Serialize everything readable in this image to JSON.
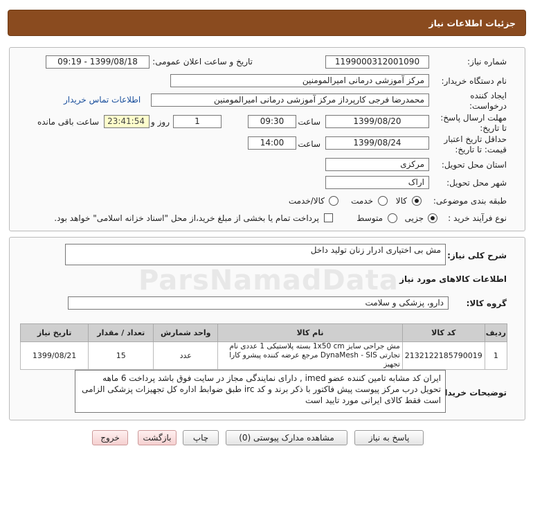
{
  "header": {
    "title": "جزئیات اطلاعات نیاز"
  },
  "info": {
    "need_number_label": "شماره نیاز:",
    "need_number": "1199000312001090",
    "announce_label": "تاریخ و ساعت اعلان عمومی:",
    "announce_value": "1399/08/18 - 09:19",
    "buyer_label": "نام دستگاه خریدار:",
    "buyer_value": "مرکز آموزشی درمانی امیرالمومنین",
    "creator_label_1": "ایجاد کننده",
    "creator_label_2": "درخواست:",
    "creator_value": "محمدرضا فرجی کارپرداز مرکز آموزشی درمانی امیرالمومنین",
    "contact_link": "اطلاعات تماس خریدار",
    "deadline_label_1": "مهلت ارسال پاسخ:",
    "deadline_label_2": "تا تاریخ:",
    "deadline_date": "1399/08/20",
    "time_label": "ساعت",
    "deadline_time": "09:30",
    "days_value": "1",
    "days_label": "روز و",
    "remaining_value": "23:41:54",
    "remaining_label": "ساعت باقی مانده",
    "validity_label_1": "حداقل تاریخ اعتبار",
    "validity_label_2": "قیمت: تا تاریخ:",
    "validity_date": "1399/08/24",
    "validity_time_label": "ساعت",
    "validity_time": "14:00",
    "province_label": "استان محل تحویل:",
    "province_value": "مرکزی",
    "city_label": "شهر محل تحویل:",
    "city_value": "اراک",
    "category_label": "طبقه بندی موضوعی:",
    "category_options": [
      "کالا",
      "خدمت",
      "کالا/خدمت"
    ],
    "category_selected": "کالا",
    "process_label": "نوع فرآیند خرید :",
    "process_options": [
      "جزیی",
      "متوسط"
    ],
    "process_selected": "جزیی",
    "payment_note": "پرداخت تمام یا بخشی از مبلغ خرید،از محل \"اسناد خزانه اسلامی\" خواهد بود."
  },
  "summary": {
    "label": "شرح کلی نیاز:",
    "value": "مش بی اختیاری ادرار زنان   تولید داخل"
  },
  "goods": {
    "section_title": "اطلاعات کالاهای مورد نیاز",
    "group_label": "گروه کالا:",
    "group_value": "دارو، پزشکی و سلامت",
    "columns": [
      "ردیف",
      "کد کالا",
      "نام کالا",
      "واحد شمارش",
      "تعداد / مقدار",
      "تاریخ نیاز"
    ],
    "rows": [
      {
        "index": "1",
        "code": "2132122185790019",
        "name": "مش جراحی سایز 1x50 cm بسته پلاستیکی 1 عددی نام تجارتی DynaMesh - SIS مرجع عرضه کننده پیشرو کارا تجهیز",
        "unit": "عدد",
        "qty": "15",
        "date": "1399/08/21"
      }
    ]
  },
  "buyer_notes": {
    "label": "توضیحات خریدار:",
    "value": "ایران کد مشابه تامین کننده عضو imed , دارای نمایندگی مجاز در سایت فوق باشد  پرداخت 6 ماهه تحویل درب مرکز پیوست پیش فاکتور با ذکر برند و کد irc  طبق ضوابط اداره کل تجهیزات پزشکی الزامی است فقط کالای ایرانی مورد تایید است"
  },
  "buttons": {
    "reply": "پاسخ به نیاز",
    "attachments": "مشاهده مدارک پیوستی (0)",
    "print": "چاپ",
    "back": "بازگشت",
    "exit": "خروج"
  },
  "colors": {
    "header_bg": "#8a4b1f",
    "link": "#1a4f9c",
    "countdown_bg": "#ffffcc"
  }
}
